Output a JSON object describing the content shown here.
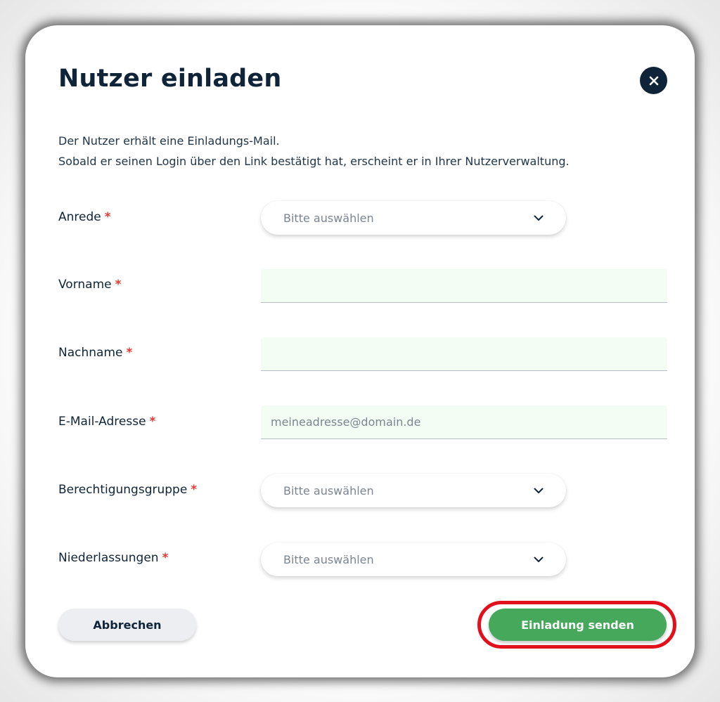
{
  "dialog": {
    "title": "Nutzer einladen",
    "close_icon": "close-icon",
    "description_lines": [
      "Der Nutzer erhält eine Einladungs-Mail.",
      "Sobald er seinen Login über den Link bestätigt hat, erscheint er in Ihrer Nutzerverwaltung."
    ]
  },
  "form": {
    "required_marker": "*",
    "salutation": {
      "label": "Anrede",
      "placeholder": "Bitte auswählen"
    },
    "first_name": {
      "label": "Vorname",
      "value": "",
      "placeholder": ""
    },
    "last_name": {
      "label": "Nachname",
      "value": "",
      "placeholder": ""
    },
    "email": {
      "label": "E-Mail-Adresse",
      "value": "",
      "placeholder": "meineadresse@domain.de"
    },
    "permission_group": {
      "label": "Berechtigungsgruppe",
      "placeholder": "Bitte auswählen"
    },
    "branches": {
      "label": "Niederlassungen",
      "placeholder": "Bitte auswählen"
    }
  },
  "actions": {
    "cancel_label": "Abbrechen",
    "send_label": "Einladung senden"
  },
  "colors": {
    "primary_text": "#0f2438",
    "required": "#e53935",
    "send_button": "#46a85a",
    "input_background": "#f3fdf3",
    "highlight_ring": "#e2101c"
  }
}
